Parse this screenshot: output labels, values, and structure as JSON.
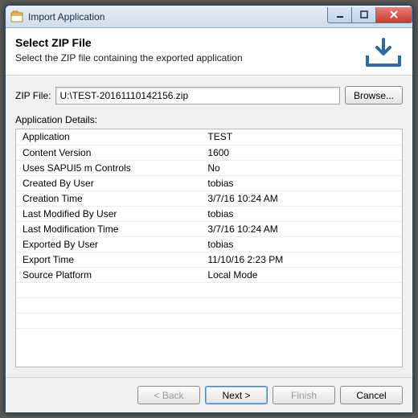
{
  "window": {
    "title": "Import Application"
  },
  "header": {
    "title": "Select ZIP File",
    "subtitle": "Select the ZIP file containing the exported application"
  },
  "zip": {
    "label": "ZIP File:",
    "value": "U:\\TEST-20161110142156.zip",
    "browse_label": "Browse..."
  },
  "details": {
    "section_label": "Application Details:",
    "rows": [
      {
        "label": "Application",
        "value": "TEST",
        "indent": 0
      },
      {
        "label": "Content Version",
        "value": "1600",
        "indent": 1
      },
      {
        "label": "Uses SAPUI5 m Controls",
        "value": "No",
        "indent": 1
      },
      {
        "label": "Created By User",
        "value": "tobias",
        "indent": 1
      },
      {
        "label": "Creation Time",
        "value": "3/7/16 10:24 AM",
        "indent": 1
      },
      {
        "label": "Last Modified By User",
        "value": "tobias",
        "indent": 1
      },
      {
        "label": "Last Modification Time",
        "value": "3/7/16 10:24 AM",
        "indent": 1
      },
      {
        "label": "Exported By User",
        "value": "tobias",
        "indent": 1
      },
      {
        "label": "Export Time",
        "value": "11/10/16 2:23 PM",
        "indent": 1
      },
      {
        "label": "Source Platform",
        "value": "Local Mode",
        "indent": 0
      }
    ]
  },
  "footer": {
    "back_label": "< Back",
    "next_label": "Next >",
    "finish_label": "Finish",
    "cancel_label": "Cancel"
  }
}
